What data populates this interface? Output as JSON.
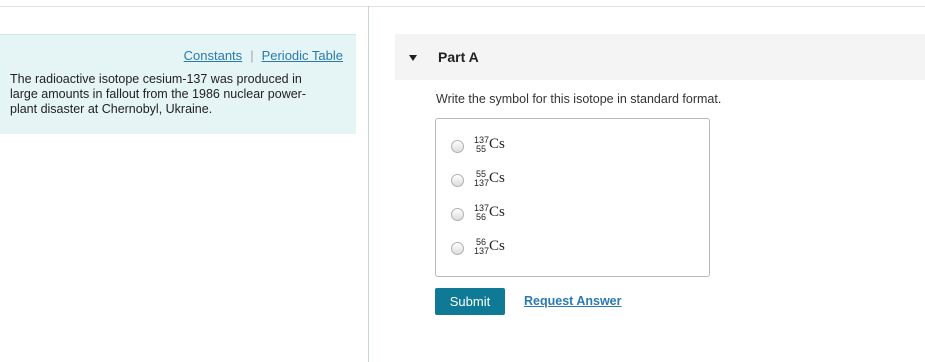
{
  "resources": {
    "constants_label": "Constants",
    "separator": "|",
    "periodic_table_label": "Periodic Table"
  },
  "problem": {
    "text": "The radioactive isotope cesium-137 was produced in large amounts in fallout from the 1986 nuclear power-plant disaster at Chernobyl, Ukraine."
  },
  "part": {
    "title": "Part A",
    "question": "Write the symbol for this isotope in standard format.",
    "options": [
      {
        "top": "137",
        "bottom": "55",
        "symbol": "Cs",
        "selected": false
      },
      {
        "top": "55",
        "bottom": "137",
        "symbol": "Cs",
        "selected": false
      },
      {
        "top": "137",
        "bottom": "56",
        "symbol": "Cs",
        "selected": false
      },
      {
        "top": "56",
        "bottom": "137",
        "symbol": "Cs",
        "selected": false
      }
    ]
  },
  "actions": {
    "submit_label": "Submit",
    "request_answer_label": "Request Answer"
  },
  "colors": {
    "panel_background": "#e5f4f5",
    "link": "#2a7ab0",
    "submit_button": "#0f7a95"
  }
}
